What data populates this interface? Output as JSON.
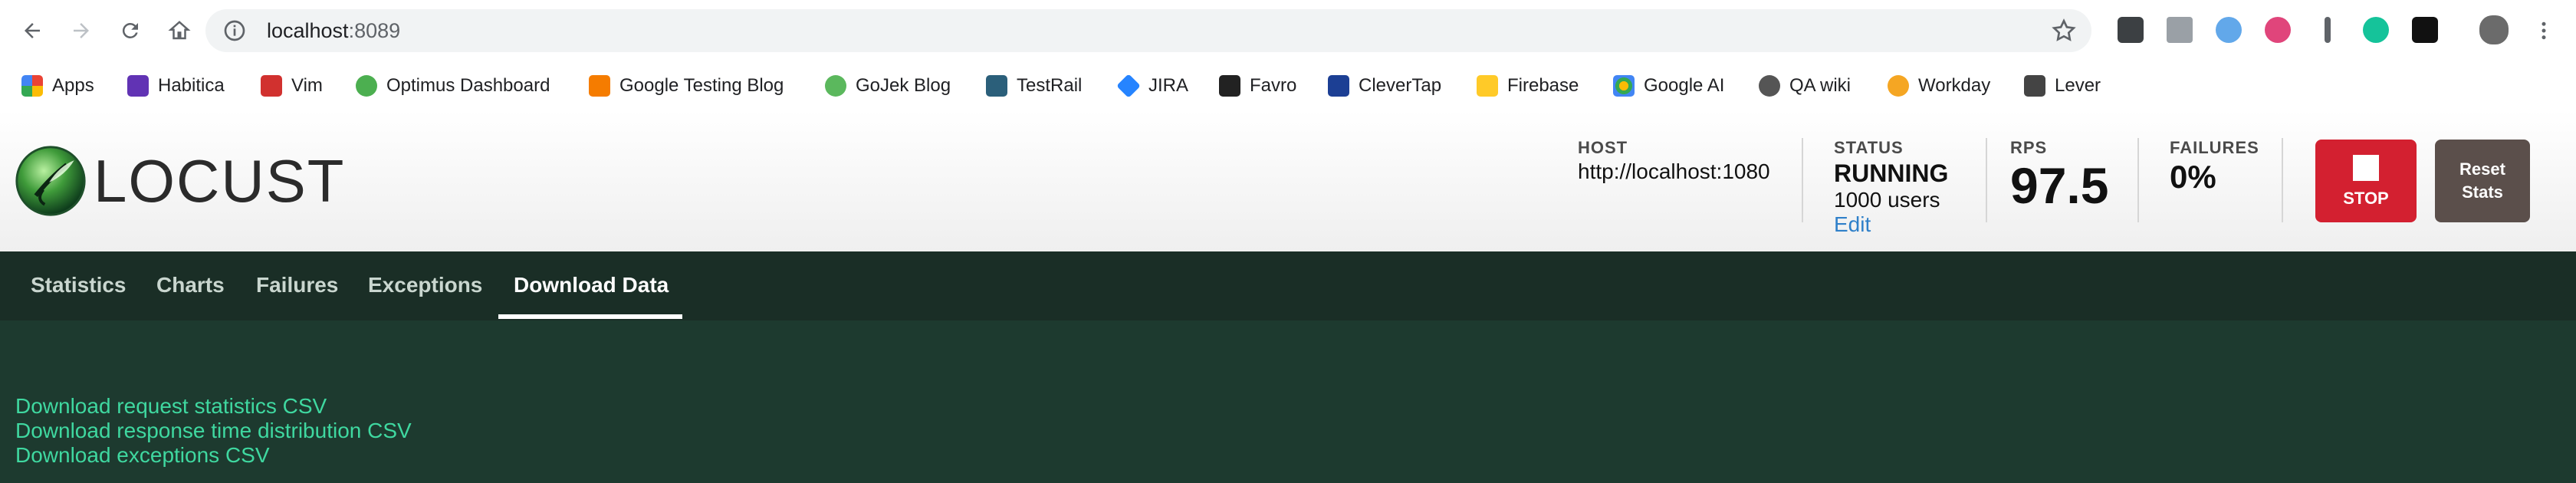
{
  "browser": {
    "url_host": "localhost",
    "url_port": ":8089",
    "bookmarks": [
      "Apps",
      "Habitica",
      "Vim",
      "Optimus Dashboard",
      "Google Testing Blog",
      "GoJek Blog",
      "TestRail",
      "JIRA",
      "Favro",
      "CleverTap",
      "Firebase",
      "Google AI",
      "QA wiki",
      "Workday",
      "Lever"
    ],
    "icons": [
      "back-icon",
      "forward-icon",
      "reload-icon",
      "home-icon",
      "info-icon",
      "star-icon",
      "menu-icon"
    ]
  },
  "app": {
    "logo_text": "LOCUST",
    "host_label": "HOST",
    "host_value": "http://localhost:1080",
    "status_label": "STATUS",
    "status_value": "RUNNING",
    "users": "1000 users",
    "edit_label": "Edit",
    "rps_label": "RPS",
    "rps_value": "97.5",
    "failures_label": "FAILURES",
    "failures_value": "0%",
    "stop_label": "STOP",
    "reset_label_1": "Reset",
    "reset_label_2": "Stats"
  },
  "tabs": [
    "Statistics",
    "Charts",
    "Failures",
    "Exceptions",
    "Download Data"
  ],
  "active_tab": "Download Data",
  "downloads": [
    "Download request statistics CSV",
    "Download response time distribution CSV",
    "Download exceptions CSV"
  ],
  "colors": {
    "stop": "#d32030",
    "reset": "#5b4f4b",
    "content_bg": "#1d3a2f",
    "link": "#3fd8a0"
  }
}
